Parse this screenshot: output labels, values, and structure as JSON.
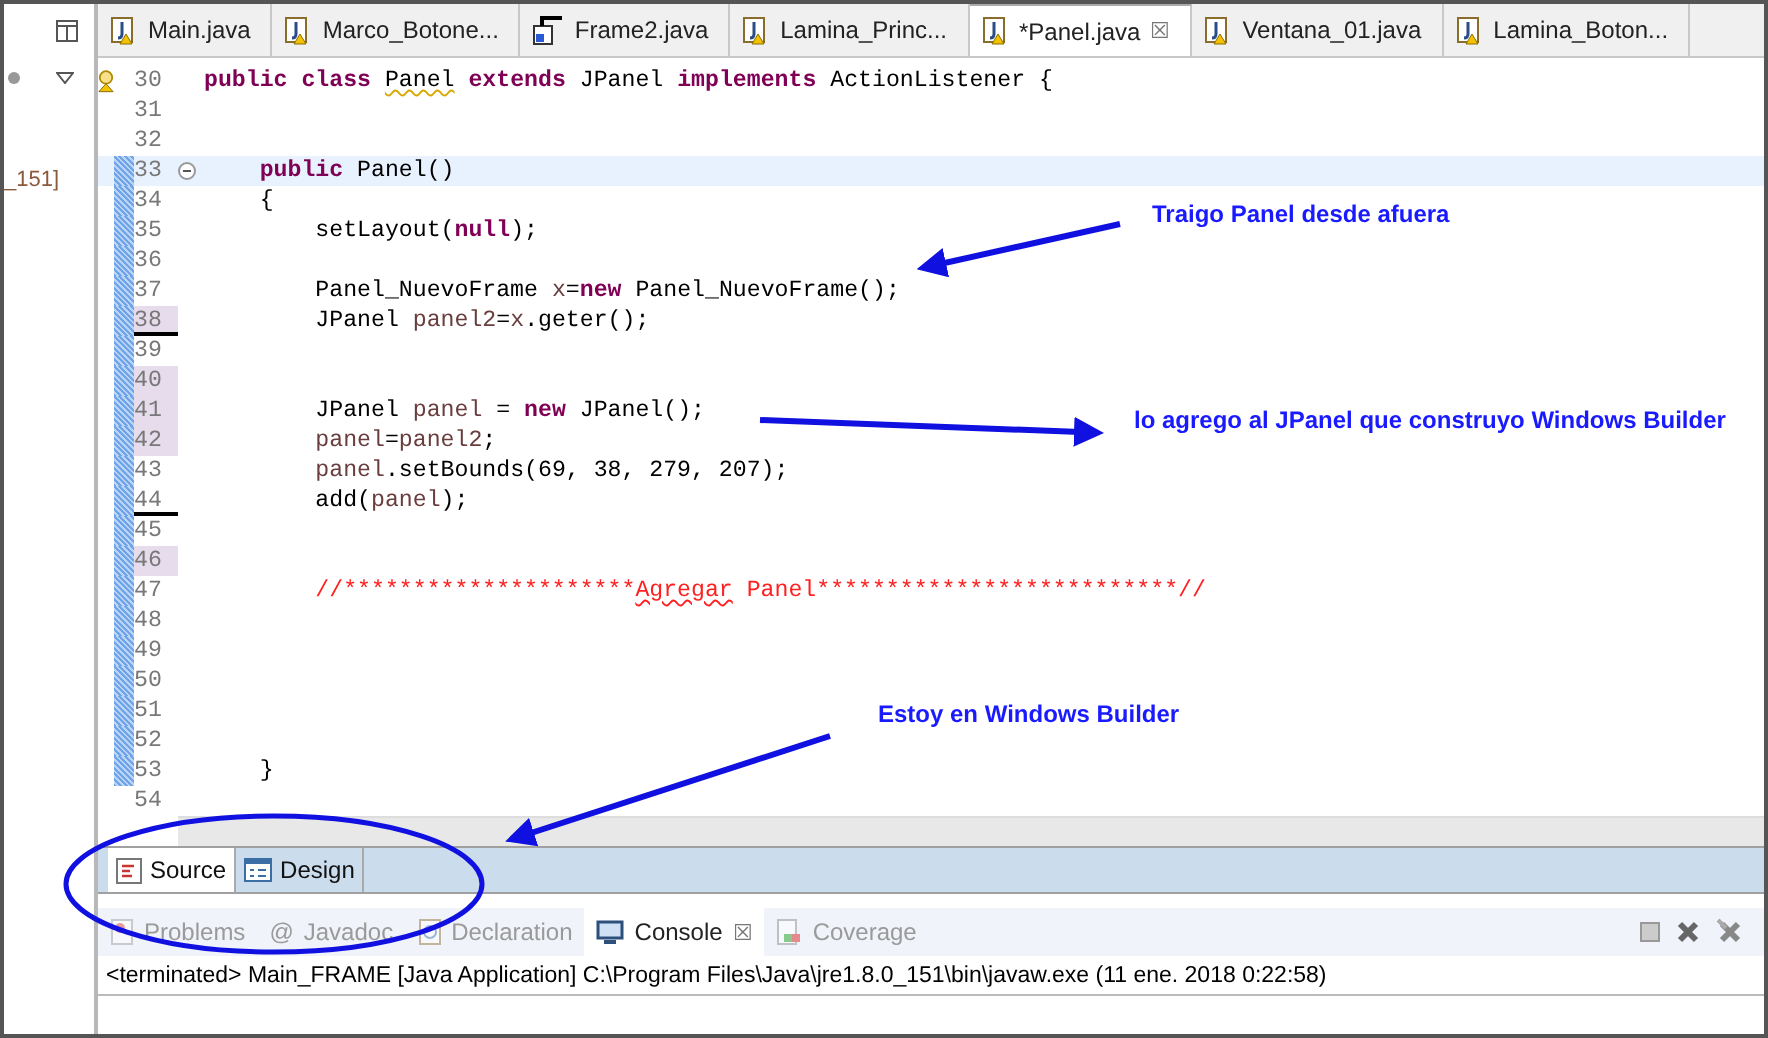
{
  "side_panel": {
    "text": "_151]"
  },
  "tabs": [
    {
      "label": "Main.java",
      "kind": "java",
      "selected": false
    },
    {
      "label": "Marco_Botone...",
      "kind": "java",
      "selected": false
    },
    {
      "label": "Frame2.java",
      "kind": "frame",
      "selected": false
    },
    {
      "label": "Lamina_Princ...",
      "kind": "java",
      "selected": false
    },
    {
      "label": "*Panel.java",
      "kind": "java",
      "selected": true,
      "close": "☒"
    },
    {
      "label": "Ventana_01.java",
      "kind": "java",
      "selected": false
    },
    {
      "label": "Lamina_Boton...",
      "kind": "java",
      "selected": false
    }
  ],
  "editor": {
    "lines": [
      {
        "number": "30",
        "kind": "warning",
        "changed": false,
        "current": false,
        "highlighted": false,
        "underlined": false,
        "tokens": [
          {
            "kind": "keyword",
            "text": "public "
          },
          {
            "kind": "keyword",
            "text": "class "
          },
          {
            "kind": "warning",
            "text": "Panel"
          },
          {
            "kind": "keyword",
            "text": " extends"
          },
          {
            "kind": "plain",
            "text": " JPanel "
          },
          {
            "kind": "keyword",
            "text": "implements"
          },
          {
            "kind": "plain",
            "text": " ActionListener {"
          }
        ]
      },
      {
        "number": "31",
        "kind": "code",
        "changed": false,
        "current": false,
        "highlighted": false,
        "underlined": false
      },
      {
        "number": "32",
        "kind": "code",
        "changed": false,
        "current": false,
        "highlighted": false,
        "underlined": false
      },
      {
        "number": "33",
        "kind": "fold",
        "changed": true,
        "current": true,
        "highlighted": false,
        "underlined": false,
        "tokens": [
          {
            "kind": "keyword",
            "text": "    public"
          },
          {
            "kind": "plain",
            "text": " Panel()"
          }
        ]
      },
      {
        "number": "34",
        "kind": "code",
        "changed": true,
        "current": false,
        "highlighted": false,
        "underlined": false,
        "tokens": [
          {
            "kind": "plain",
            "text": "    {"
          }
        ]
      },
      {
        "number": "35",
        "kind": "code",
        "changed": true,
        "current": false,
        "highlighted": false,
        "underlined": false,
        "tokens": [
          {
            "kind": "plain",
            "text": "        setLayout("
          },
          {
            "kind": "keyword",
            "text": "null"
          },
          {
            "kind": "plain",
            "text": ");"
          }
        ]
      },
      {
        "number": "36",
        "kind": "code",
        "changed": true,
        "current": false,
        "highlighted": false,
        "underlined": false
      },
      {
        "number": "37",
        "kind": "code",
        "changed": true,
        "current": false,
        "highlighted": false,
        "underlined": false,
        "tokens": [
          {
            "kind": "plain",
            "text": "        Panel_NuevoFrame "
          },
          {
            "kind": "variable",
            "text": "x"
          },
          {
            "kind": "plain",
            "text": "="
          },
          {
            "kind": "keyword",
            "text": "new"
          },
          {
            "kind": "plain",
            "text": " Panel_NuevoFrame();"
          }
        ]
      },
      {
        "number": "38",
        "kind": "code",
        "changed": true,
        "current": false,
        "highlighted": true,
        "underlined": true,
        "tokens": [
          {
            "kind": "plain",
            "text": "        JPanel "
          },
          {
            "kind": "variable",
            "text": "panel2"
          },
          {
            "kind": "plain",
            "text": "="
          },
          {
            "kind": "variable",
            "text": "x"
          },
          {
            "kind": "plain",
            "text": ".geter();"
          }
        ]
      },
      {
        "number": "39",
        "kind": "code",
        "changed": true,
        "current": false,
        "highlighted": false,
        "underlined": false
      },
      {
        "number": "40",
        "kind": "code",
        "changed": true,
        "current": false,
        "highlighted": true,
        "underlined": false
      },
      {
        "number": "41",
        "kind": "code",
        "changed": true,
        "current": false,
        "highlighted": true,
        "underlined": false,
        "tokens": [
          {
            "kind": "plain",
            "text": "        JPanel "
          },
          {
            "kind": "variable",
            "text": "panel"
          },
          {
            "kind": "plain",
            "text": " = "
          },
          {
            "kind": "keyword",
            "text": "new"
          },
          {
            "kind": "plain",
            "text": " JPanel();"
          }
        ]
      },
      {
        "number": "42",
        "kind": "code",
        "changed": true,
        "current": false,
        "highlighted": true,
        "underlined": false,
        "tokens": [
          {
            "kind": "variable",
            "text": "        panel"
          },
          {
            "kind": "plain",
            "text": "="
          },
          {
            "kind": "variable",
            "text": "panel2"
          },
          {
            "kind": "plain",
            "text": ";"
          }
        ]
      },
      {
        "number": "43",
        "kind": "code",
        "changed": true,
        "current": false,
        "highlighted": false,
        "underlined": false,
        "tokens": [
          {
            "kind": "variable",
            "text": "        panel"
          },
          {
            "kind": "plain",
            "text": ".setBounds(69, 38, 279, 207);"
          }
        ]
      },
      {
        "number": "44",
        "kind": "code",
        "changed": true,
        "current": false,
        "highlighted": false,
        "underlined": true,
        "tokens": [
          {
            "kind": "plain",
            "text": "        add("
          },
          {
            "kind": "variable",
            "text": "panel"
          },
          {
            "kind": "plain",
            "text": ");"
          }
        ]
      },
      {
        "number": "45",
        "kind": "code",
        "changed": true,
        "current": false,
        "highlighted": false,
        "underlined": false
      },
      {
        "number": "46",
        "kind": "code",
        "changed": true,
        "current": false,
        "highlighted": true,
        "underlined": false
      },
      {
        "number": "47",
        "kind": "code",
        "changed": true,
        "current": false,
        "highlighted": false,
        "underlined": false,
        "tokens": [
          {
            "kind": "comment",
            "text": "        //*********************"
          },
          {
            "kind": "misspelled",
            "text": "Agregar"
          },
          {
            "kind": "comment",
            "text": " Panel**************************//"
          }
        ]
      },
      {
        "number": "48",
        "kind": "code",
        "changed": true,
        "current": false,
        "highlighted": false,
        "underlined": false
      },
      {
        "number": "49",
        "kind": "code",
        "changed": true,
        "current": false,
        "highlighted": false,
        "underlined": false
      },
      {
        "number": "50",
        "kind": "code",
        "changed": true,
        "current": false,
        "highlighted": false,
        "underlined": false
      },
      {
        "number": "51",
        "kind": "code",
        "changed": true,
        "current": false,
        "highlighted": false,
        "underlined": false
      },
      {
        "number": "52",
        "kind": "code",
        "changed": true,
        "current": false,
        "highlighted": false,
        "underlined": false
      },
      {
        "number": "53",
        "kind": "code",
        "changed": true,
        "current": false,
        "highlighted": false,
        "underlined": false,
        "tokens": [
          {
            "kind": "plain",
            "text": "    }"
          }
        ]
      },
      {
        "number": "54",
        "kind": "code",
        "changed": false,
        "current": false,
        "highlighted": false,
        "underlined": false
      }
    ]
  },
  "editor_tabs": [
    {
      "label": "Source",
      "selected": true
    },
    {
      "label": "Design",
      "selected": false
    }
  ],
  "console_tabs": [
    {
      "label": "Problems",
      "selected": false
    },
    {
      "label": "Javadoc",
      "symbol": "@",
      "selected": false
    },
    {
      "label": "Declaration",
      "selected": false
    },
    {
      "label": "Console",
      "selected": true,
      "close": "☒"
    },
    {
      "label": "Coverage",
      "selected": false
    }
  ],
  "console": {
    "text": "<terminated> Main_FRAME [Java Application] C:\\Program Files\\Java\\jre1.8.0_151\\bin\\javaw.exe (11 ene. 2018 0:22:58)"
  },
  "annotations": [
    {
      "text": "Traigo Panel desde afuera"
    },
    {
      "text": "lo agrego al JPanel que construyo Windows Builder"
    },
    {
      "text": "Estoy en Windows Builder"
    }
  ]
}
